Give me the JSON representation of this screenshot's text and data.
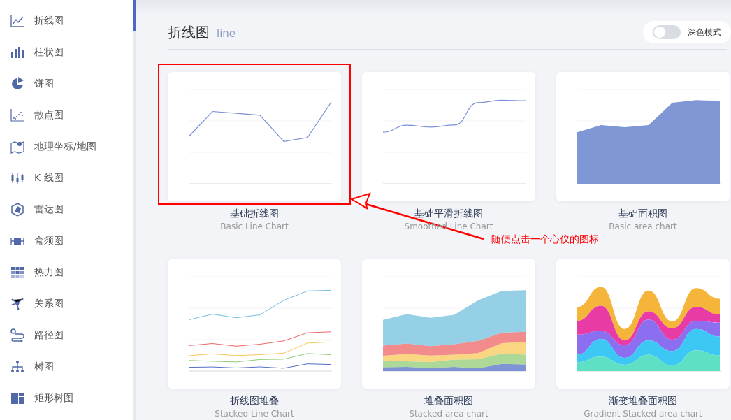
{
  "sidebar": {
    "items": [
      {
        "kind": "line",
        "label": "折线图"
      },
      {
        "kind": "bar",
        "label": "柱状图"
      },
      {
        "kind": "pie",
        "label": "饼图"
      },
      {
        "kind": "scatter",
        "label": "散点图"
      },
      {
        "kind": "map",
        "label": "地理坐标/地图"
      },
      {
        "kind": "candlestick",
        "label": "K 线图"
      },
      {
        "kind": "radar",
        "label": "雷达图"
      },
      {
        "kind": "boxplot",
        "label": "盒须图"
      },
      {
        "kind": "heatmap",
        "label": "热力图"
      },
      {
        "kind": "graph",
        "label": "关系图"
      },
      {
        "kind": "lines",
        "label": "路径图"
      },
      {
        "kind": "tree",
        "label": "树图"
      },
      {
        "kind": "treemap",
        "label": "矩形树图"
      }
    ]
  },
  "header": {
    "title": "折线图",
    "subtitle": "line",
    "dark_mode": {
      "label": "深色模式",
      "on": false
    }
  },
  "examples": [
    {
      "title": "基础折线图",
      "subtitle": "Basic Line Chart",
      "highlighted": true
    },
    {
      "title": "基础平滑折线图",
      "subtitle": "Smoothed Line Chart",
      "highlighted": false
    },
    {
      "title": "基础面积图",
      "subtitle": "Basic area chart",
      "highlighted": false
    },
    {
      "title": "折线图堆叠",
      "subtitle": "Stacked Line Chart",
      "highlighted": false
    },
    {
      "title": "堆叠面积图",
      "subtitle": "Stacked area chart",
      "highlighted": false
    },
    {
      "title": "渐变堆叠面积图",
      "subtitle": "Gradient Stacked area chart",
      "highlighted": false
    }
  ],
  "annotation": {
    "text": "随便点击一个心仪的图标"
  }
}
